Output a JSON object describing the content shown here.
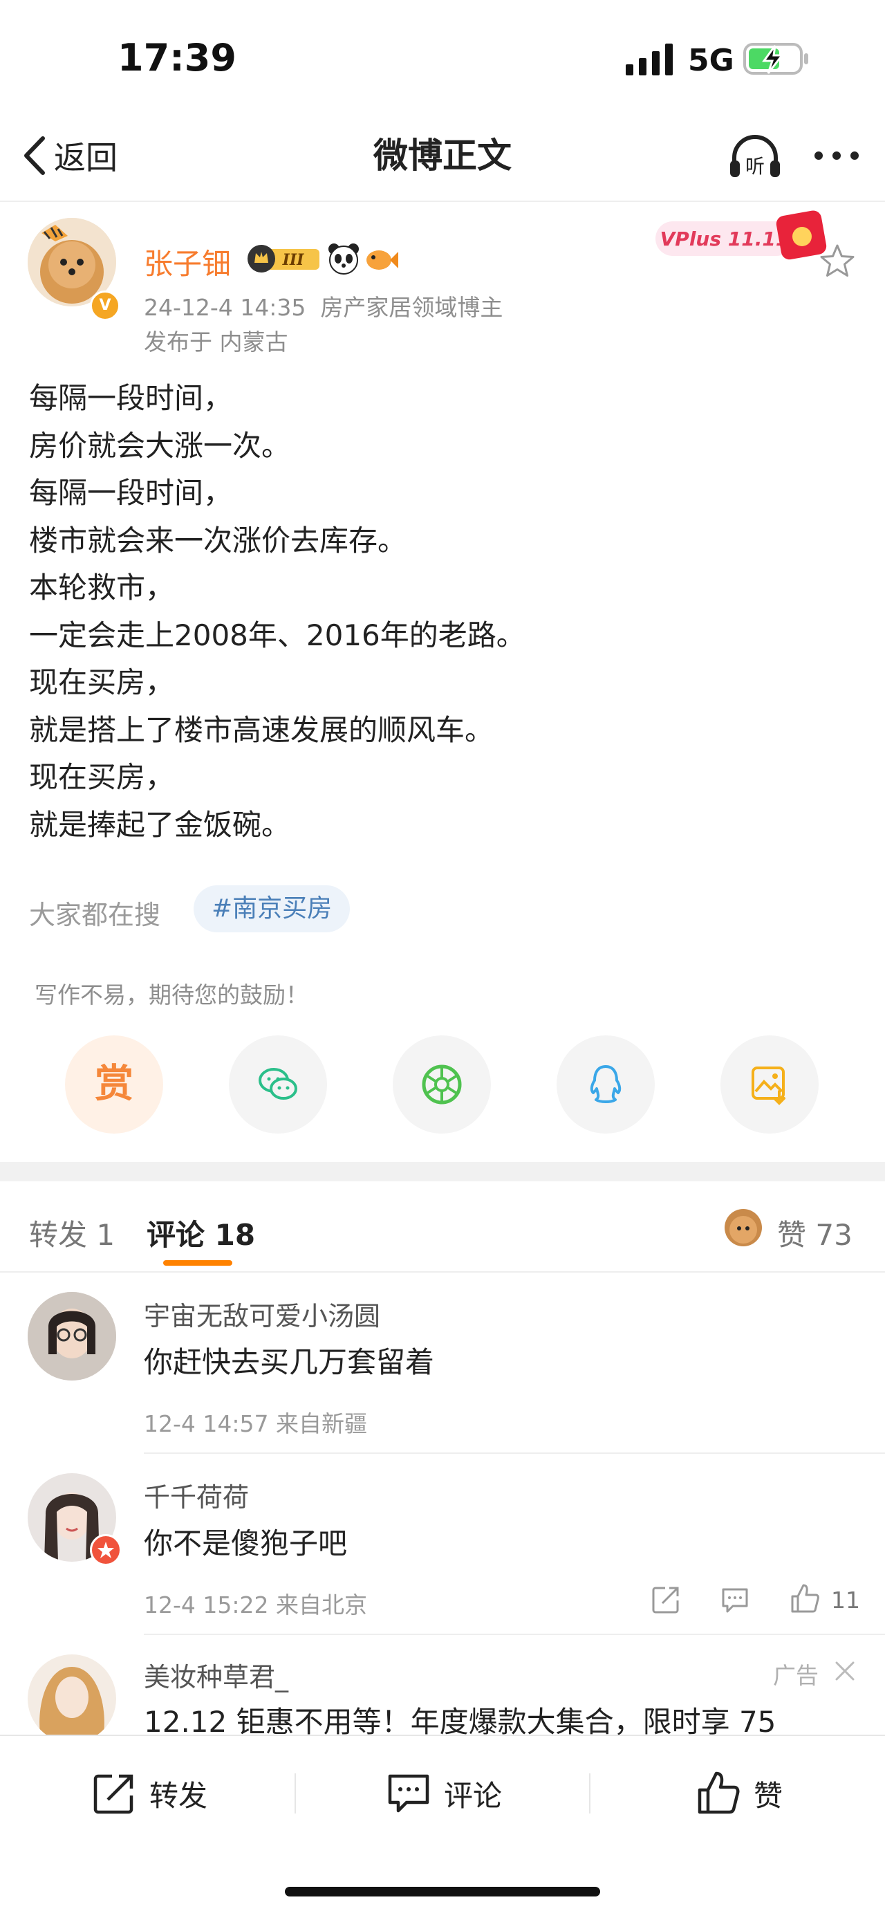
{
  "status_bar": {
    "time": "17:39",
    "network": "5G"
  },
  "nav": {
    "back_label": "返回",
    "title": "微博正文",
    "listen_icon_text": "听"
  },
  "author": {
    "name": "张子钿",
    "badge_level": "III",
    "time": "24-12-4 14:35",
    "role": "房产家居领域博主",
    "location": "发布于 内蒙古",
    "promo_text": "VPlus 11.11"
  },
  "post": {
    "lines": [
      "每隔一段时间，",
      "房价就会大涨一次。",
      "每隔一段时间，",
      "楼市就会来一次涨价去库存。",
      "本轮救市，",
      "一定会走上2008年、2016年的老路。",
      "现在买房，",
      "就是搭上了楼市高速发展的顺风车。",
      "现在买房，",
      "就是捧起了金饭碗。"
    ]
  },
  "hot_search": {
    "label": "大家都在搜",
    "topic": "#南京买房"
  },
  "reward": {
    "tip": "写作不易，期待您的鼓励！",
    "button": "赏"
  },
  "share_targets": [
    "wechat-icon",
    "moments-icon",
    "qq-icon",
    "save-image-icon"
  ],
  "tabs": {
    "repost": "转发 1",
    "comment": "评论 18",
    "like": "赞 73"
  },
  "comments": [
    {
      "name": "宇宙无敌可爱小汤圆",
      "text": "你赶快去买几万套留着",
      "meta": "12-4 14:57 来自新疆",
      "likes": ""
    },
    {
      "name": "千千荷荷",
      "text": "你不是傻狍子吧",
      "meta": "12-4 15:22 来自北京",
      "likes": "11"
    },
    {
      "name": "美妆种草君_",
      "text": "12.12 钜惠不用等！年度爆款大集合，限时享 75",
      "meta": "",
      "likes": "",
      "ad_tag": "广告"
    }
  ],
  "bottom_bar": {
    "repost": "转发",
    "comment": "评论",
    "like": "赞"
  },
  "colors": {
    "accent": "#ff8200",
    "name_orange": "#f77c2e",
    "link_blue": "#4a7fb8"
  }
}
